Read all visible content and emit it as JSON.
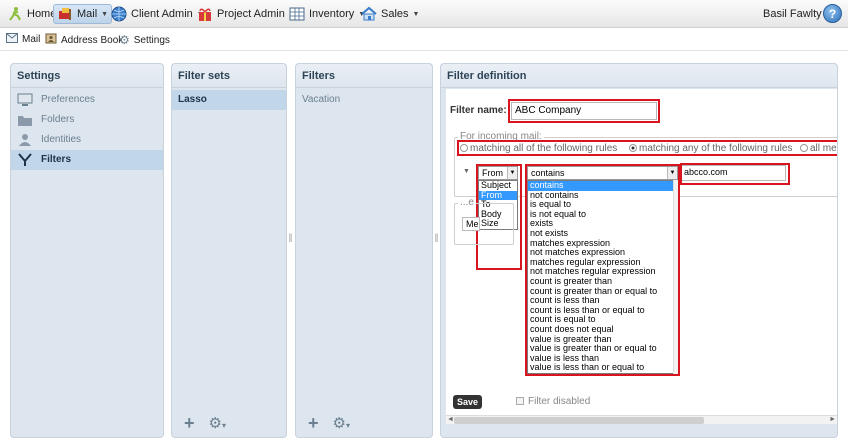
{
  "topbar": {
    "home": "Home",
    "mail": "Mail",
    "client_admin": "Client Admin",
    "project_admin": "Project Admin",
    "inventory": "Inventory",
    "sales": "Sales",
    "user": "Basil Fawlty",
    "help": "?"
  },
  "subbar": {
    "mail": "Mail",
    "address_book": "Address Book",
    "settings": "Settings"
  },
  "settings_panel": {
    "title": "Settings",
    "items": [
      {
        "label": "Preferences",
        "icon": "monitor-icon"
      },
      {
        "label": "Folders",
        "icon": "folder-icon"
      },
      {
        "label": "Identities",
        "icon": "person-icon"
      },
      {
        "label": "Filters",
        "icon": "filter-icon",
        "selected": true
      }
    ]
  },
  "filter_sets_panel": {
    "title": "Filter sets",
    "items": [
      {
        "label": "Lasso",
        "selected": true
      }
    ]
  },
  "filters_panel": {
    "title": "Filters",
    "items": [
      {
        "label": "Vacation"
      }
    ]
  },
  "definition": {
    "title": "Filter definition",
    "name_label": "Filter name:",
    "name_value": "ABC Company",
    "incoming_legend": "For incoming mail:",
    "radio_all": "matching all of the following rules",
    "radio_any": "matching any of the following rules",
    "radio_all_messages": "all mes",
    "rule_header": "From",
    "rule_operator": "contains",
    "rule_value": "abcco.com",
    "header_options": [
      "Subject",
      "From",
      "To",
      "Body",
      "Size"
    ],
    "header_selected": "From",
    "operator_options": [
      "contains",
      "not contains",
      "is equal to",
      "is not equal to",
      "exists",
      "not exists",
      "matches expression",
      "not matches expression",
      "matches regular expression",
      "not matches regular expression",
      "count is greater than",
      "count is greater than or equal to",
      "count is less than",
      "count is less than or equal to",
      "count is equal to",
      "count does not equal",
      "value is greater than",
      "value is greater than or equal to",
      "value is less than",
      "value is less than or equal to"
    ],
    "operator_selected": "contains",
    "actions_legend": "...e",
    "action_value": "Me",
    "save_label": "Save",
    "disabled_label": "Filter disabled"
  },
  "colors": {
    "panel_bg": "#dde5ee",
    "highlight_red": "#d8141f",
    "selection_blue": "#3399ff"
  }
}
